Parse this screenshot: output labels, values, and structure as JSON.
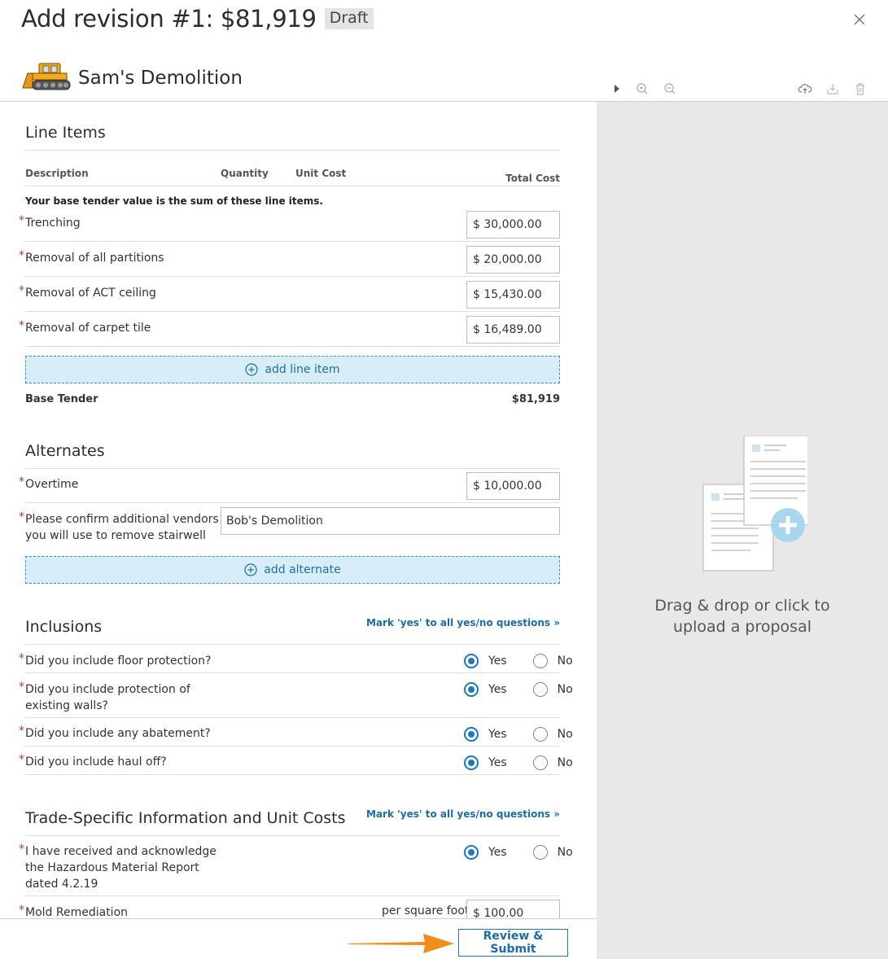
{
  "header": {
    "title": "Add revision #1: $81,919",
    "status_badge": "Draft",
    "company_name": "Sam's Demolition"
  },
  "colors": {
    "accent": "#1a78c2",
    "dashed_button_bg": "#d7edf7",
    "required_mark": "#c0392b",
    "arrow": "#f28c1b",
    "panel_bg": "#e8e8e8"
  },
  "viewer_toolbar": {
    "icons": [
      "play-icon",
      "zoom-in-icon",
      "zoom-out-icon",
      "cloud-upload-icon",
      "download-icon",
      "trash-icon"
    ]
  },
  "dropzone": {
    "line1": "Drag & drop or click to",
    "line2": "upload a proposal"
  },
  "line_items": {
    "title": "Line Items",
    "columns": [
      "Description",
      "Quantity",
      "Unit Cost",
      "Total Cost"
    ],
    "note": "Your base tender value is the sum of these line items.",
    "items": [
      {
        "label": "Trenching",
        "value": "$ 30,000.00"
      },
      {
        "label": "Removal of all partitions",
        "value": "$ 20,000.00"
      },
      {
        "label": "Removal of ACT ceiling",
        "value": "$ 15,430.00"
      },
      {
        "label": "Removal of carpet tile",
        "value": "$ 16,489.00"
      }
    ],
    "add_label": "add line item",
    "total_label": "Base Tender",
    "total_value": "$81,919"
  },
  "alternates": {
    "title": "Alternates",
    "overtime_label": "Overtime",
    "overtime_value": "$ 10,000.00",
    "vendors_label_line1": "Please confirm additional vendors",
    "vendors_label_line2": "you will use to remove stairwell",
    "vendors_value": "Bob's Demolition",
    "add_label": "add alternate"
  },
  "inclusions": {
    "title": "Inclusions",
    "mark_all": "Mark 'yes' to all yes/no questions »",
    "yes": "Yes",
    "no": "No",
    "questions": [
      {
        "line1": "Did you include floor protection?",
        "line2": "",
        "answer": "Yes"
      },
      {
        "line1": "Did you include protection of",
        "line2": "existing walls?",
        "answer": "Yes"
      },
      {
        "line1": "Did you include any abatement?",
        "line2": "",
        "answer": "Yes"
      },
      {
        "line1": "Did you include haul off?",
        "line2": "",
        "answer": "Yes"
      }
    ]
  },
  "trade_specific": {
    "title": "Trade-Specific Information and Unit Costs",
    "mark_all": "Mark 'yes' to all yes/no questions »",
    "hazard_line1": "I have received and acknowledge",
    "hazard_line2": "the Hazardous Material Report",
    "hazard_line3": "dated 4.2.19",
    "hazard_answer": "Yes",
    "mold_label": "Mold Remediation",
    "mold_unit": "per square foot",
    "mold_value": "$ 100.00"
  },
  "footer": {
    "submit_label": "Review & Submit"
  }
}
